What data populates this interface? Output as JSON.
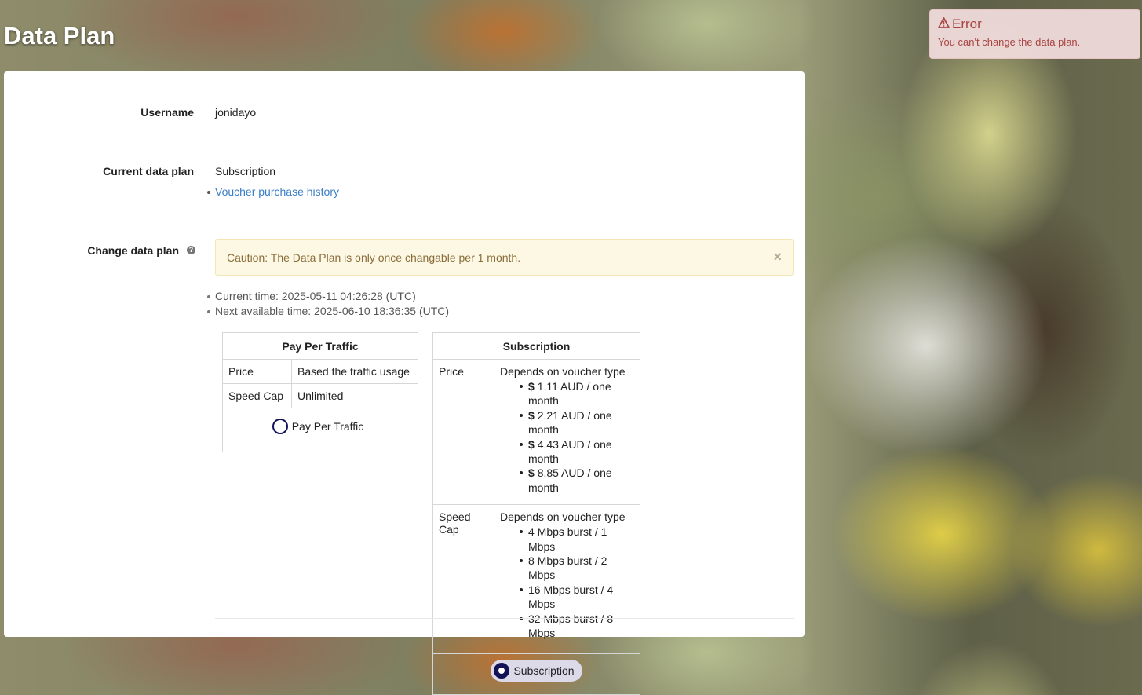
{
  "page": {
    "title": "Data Plan"
  },
  "toast": {
    "title": "Error",
    "message": "You can't change the data plan.",
    "icon": "warning-icon",
    "color": "#a94442"
  },
  "username": {
    "label": "Username",
    "value": "jonidayo"
  },
  "current_plan": {
    "label": "Current data plan",
    "value": "Subscription",
    "history_link": "Voucher purchase history"
  },
  "change_plan": {
    "label": "Change data plan",
    "caution": "Caution: The Data Plan is only once changable per 1 month.",
    "close": "×",
    "current_time": "Current time: 2025-05-11 04:26:28 (UTC)",
    "next_time": "Next available time: 2025-06-10 18:36:35 (UTC)"
  },
  "plans": {
    "ppt": {
      "title": "Pay Per Traffic",
      "price_label": "Price",
      "price_value": "Based the traffic usage",
      "speed_label": "Speed Cap",
      "speed_value": "Unlimited",
      "option": "Pay Per Traffic",
      "selected": false
    },
    "sub": {
      "title": "Subscription",
      "price_label": "Price",
      "price_value": "Depends on voucher type",
      "currency": "$",
      "prices": [
        "1.11 AUD / one month",
        "2.21 AUD / one month",
        "4.43 AUD / one month",
        "8.85 AUD / one month"
      ],
      "speed_label": "Speed Cap",
      "speed_value": "Depends on voucher type",
      "speeds": [
        "4 Mbps burst / 1 Mbps",
        "8 Mbps burst / 2 Mbps",
        "16 Mbps burst / 4 Mbps",
        "32 Mbps burst / 8 Mbps"
      ],
      "option": "Subscription",
      "selected": true
    }
  },
  "colors": {
    "accent": "#131256",
    "link": "#3a7ec6",
    "caution_bg": "#fcf8e3",
    "caution_text": "#8a6d3b"
  }
}
